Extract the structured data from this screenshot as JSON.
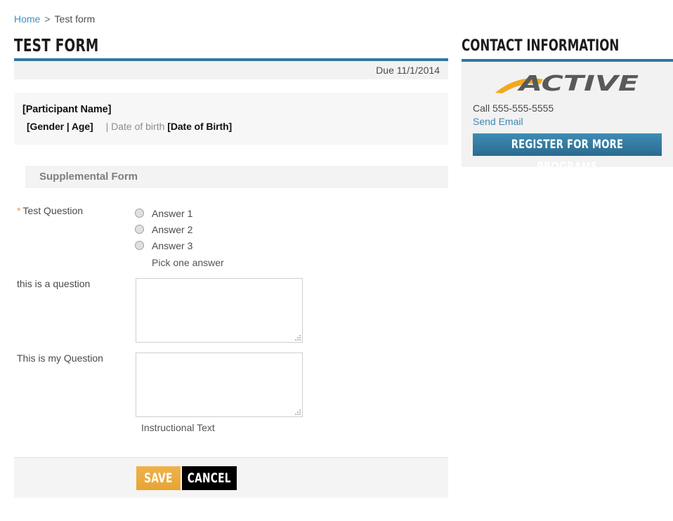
{
  "breadcrumb": {
    "home_label": "Home",
    "separator": ">",
    "current_label": "Test form"
  },
  "main": {
    "title": "TEST FORM",
    "due_text": "Due 11/1/2014",
    "participant": {
      "name": "[Participant Name]",
      "gender_age": "[Gender | Age]",
      "dob_label": "| Date of birth",
      "dob_value": "[Date of Birth]"
    },
    "section_title": "Supplemental Form",
    "questions": [
      {
        "required_marker": "*",
        "label": "Test Question",
        "type": "radio",
        "options": [
          "Answer 1",
          "Answer 2",
          "Answer 3"
        ],
        "helper": "Pick one answer"
      },
      {
        "label": "this is a question",
        "type": "textarea",
        "value": "",
        "helper": ""
      },
      {
        "label": "This is my Question",
        "type": "textarea",
        "value": "",
        "helper": "Instructional Text"
      }
    ],
    "buttons": {
      "save_label": "SAVE",
      "cancel_label": "CANCEL"
    }
  },
  "sidebar": {
    "title": "CONTACT INFORMATION",
    "logo_text": "ACTIVE",
    "phone": "Call 555-555-5555",
    "email_link": "Send Email",
    "register_label": "REGISTER FOR MORE PROGRAMS"
  },
  "colors": {
    "accent_blue": "#31789d",
    "link_blue": "#3d8fc4",
    "required_orange": "#e0a13c",
    "save_orange": "#e8a433",
    "logo_gray": "#58595b",
    "logo_gold": "#f2a81d"
  }
}
